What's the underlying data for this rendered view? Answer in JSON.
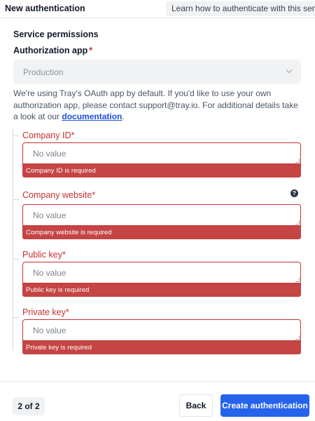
{
  "header": {
    "title": "New authentication",
    "help_link": "Learn how to authenticate with this service."
  },
  "service_permissions": {
    "title": "Service permissions"
  },
  "authorization_app": {
    "label": "Authorization app",
    "required_marker": "*",
    "selected_value": "Production"
  },
  "info": {
    "text_before": "We're using Tray's OAuth app by default. If you'd like to use your own authorization app, please contact support@tray.io. For additional details take a look at our ",
    "link_text": "documentation",
    "text_after": "."
  },
  "fields": [
    {
      "label": "Company ID*",
      "placeholder": "No value",
      "error": "Company ID is required"
    },
    {
      "label": "Company website*",
      "placeholder": "No value",
      "error": "Company website is required",
      "has_help_icon": true
    },
    {
      "label": "Public key*",
      "placeholder": "No value",
      "error": "Public key is required"
    },
    {
      "label": "Private key*",
      "placeholder": "No value",
      "error": "Private key is required"
    }
  ],
  "help_icon": {
    "glyph": "?",
    "icon": "question-circle-icon"
  },
  "footer": {
    "step": "2 of 2",
    "back_label": "Back",
    "create_label": "Create authentication"
  },
  "colors": {
    "error": "#c53030",
    "error_bar": "#c54444",
    "primary": "#2563eb",
    "select_bg": "#f1f2f4"
  }
}
